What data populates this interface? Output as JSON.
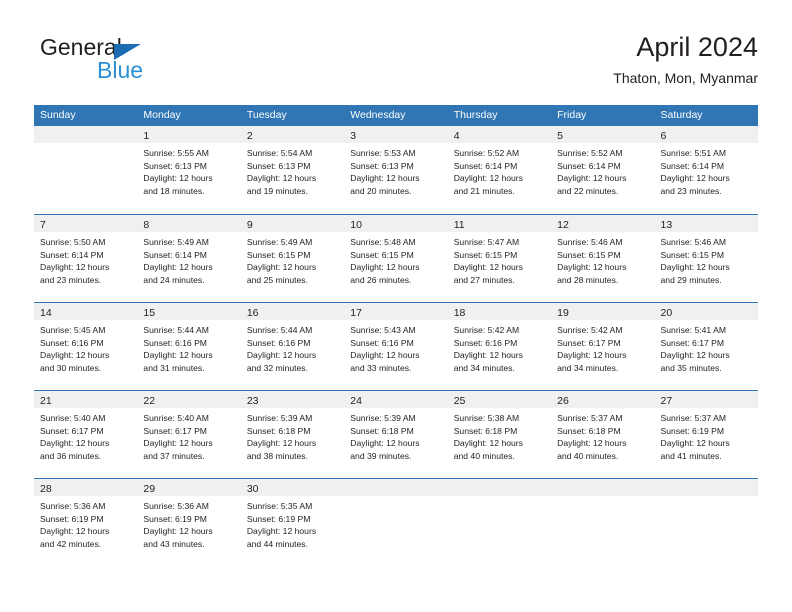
{
  "brand": {
    "name_top": "General",
    "name_bottom": "Blue",
    "triangle_icon": "blue-triangle-logo-mark",
    "color_dark": "#231f20",
    "color_blue": "#2b8fd4",
    "color_triangle": "#1b6cb3"
  },
  "header": {
    "title": "April 2024",
    "subtitle": "Thaton, Mon, Myanmar"
  },
  "theme": {
    "header_blue": "#3075b4",
    "day_band_gray": "#f0f0f0",
    "text": "#231f20"
  },
  "weekdays": [
    "Sunday",
    "Monday",
    "Tuesday",
    "Wednesday",
    "Thursday",
    "Friday",
    "Saturday"
  ],
  "weeks": [
    [
      {
        "day": "",
        "lines": []
      },
      {
        "day": "1",
        "lines": [
          "Sunrise: 5:55 AM",
          "Sunset: 6:13 PM",
          "Daylight: 12 hours",
          "and 18 minutes."
        ]
      },
      {
        "day": "2",
        "lines": [
          "Sunrise: 5:54 AM",
          "Sunset: 6:13 PM",
          "Daylight: 12 hours",
          "and 19 minutes."
        ]
      },
      {
        "day": "3",
        "lines": [
          "Sunrise: 5:53 AM",
          "Sunset: 6:13 PM",
          "Daylight: 12 hours",
          "and 20 minutes."
        ]
      },
      {
        "day": "4",
        "lines": [
          "Sunrise: 5:52 AM",
          "Sunset: 6:14 PM",
          "Daylight: 12 hours",
          "and 21 minutes."
        ]
      },
      {
        "day": "5",
        "lines": [
          "Sunrise: 5:52 AM",
          "Sunset: 6:14 PM",
          "Daylight: 12 hours",
          "and 22 minutes."
        ]
      },
      {
        "day": "6",
        "lines": [
          "Sunrise: 5:51 AM",
          "Sunset: 6:14 PM",
          "Daylight: 12 hours",
          "and 23 minutes."
        ]
      }
    ],
    [
      {
        "day": "7",
        "lines": [
          "Sunrise: 5:50 AM",
          "Sunset: 6:14 PM",
          "Daylight: 12 hours",
          "and 23 minutes."
        ]
      },
      {
        "day": "8",
        "lines": [
          "Sunrise: 5:49 AM",
          "Sunset: 6:14 PM",
          "Daylight: 12 hours",
          "and 24 minutes."
        ]
      },
      {
        "day": "9",
        "lines": [
          "Sunrise: 5:49 AM",
          "Sunset: 6:15 PM",
          "Daylight: 12 hours",
          "and 25 minutes."
        ]
      },
      {
        "day": "10",
        "lines": [
          "Sunrise: 5:48 AM",
          "Sunset: 6:15 PM",
          "Daylight: 12 hours",
          "and 26 minutes."
        ]
      },
      {
        "day": "11",
        "lines": [
          "Sunrise: 5:47 AM",
          "Sunset: 6:15 PM",
          "Daylight: 12 hours",
          "and 27 minutes."
        ]
      },
      {
        "day": "12",
        "lines": [
          "Sunrise: 5:46 AM",
          "Sunset: 6:15 PM",
          "Daylight: 12 hours",
          "and 28 minutes."
        ]
      },
      {
        "day": "13",
        "lines": [
          "Sunrise: 5:46 AM",
          "Sunset: 6:15 PM",
          "Daylight: 12 hours",
          "and 29 minutes."
        ]
      }
    ],
    [
      {
        "day": "14",
        "lines": [
          "Sunrise: 5:45 AM",
          "Sunset: 6:16 PM",
          "Daylight: 12 hours",
          "and 30 minutes."
        ]
      },
      {
        "day": "15",
        "lines": [
          "Sunrise: 5:44 AM",
          "Sunset: 6:16 PM",
          "Daylight: 12 hours",
          "and 31 minutes."
        ]
      },
      {
        "day": "16",
        "lines": [
          "Sunrise: 5:44 AM",
          "Sunset: 6:16 PM",
          "Daylight: 12 hours",
          "and 32 minutes."
        ]
      },
      {
        "day": "17",
        "lines": [
          "Sunrise: 5:43 AM",
          "Sunset: 6:16 PM",
          "Daylight: 12 hours",
          "and 33 minutes."
        ]
      },
      {
        "day": "18",
        "lines": [
          "Sunrise: 5:42 AM",
          "Sunset: 6:16 PM",
          "Daylight: 12 hours",
          "and 34 minutes."
        ]
      },
      {
        "day": "19",
        "lines": [
          "Sunrise: 5:42 AM",
          "Sunset: 6:17 PM",
          "Daylight: 12 hours",
          "and 34 minutes."
        ]
      },
      {
        "day": "20",
        "lines": [
          "Sunrise: 5:41 AM",
          "Sunset: 6:17 PM",
          "Daylight: 12 hours",
          "and 35 minutes."
        ]
      }
    ],
    [
      {
        "day": "21",
        "lines": [
          "Sunrise: 5:40 AM",
          "Sunset: 6:17 PM",
          "Daylight: 12 hours",
          "and 36 minutes."
        ]
      },
      {
        "day": "22",
        "lines": [
          "Sunrise: 5:40 AM",
          "Sunset: 6:17 PM",
          "Daylight: 12 hours",
          "and 37 minutes."
        ]
      },
      {
        "day": "23",
        "lines": [
          "Sunrise: 5:39 AM",
          "Sunset: 6:18 PM",
          "Daylight: 12 hours",
          "and 38 minutes."
        ]
      },
      {
        "day": "24",
        "lines": [
          "Sunrise: 5:39 AM",
          "Sunset: 6:18 PM",
          "Daylight: 12 hours",
          "and 39 minutes."
        ]
      },
      {
        "day": "25",
        "lines": [
          "Sunrise: 5:38 AM",
          "Sunset: 6:18 PM",
          "Daylight: 12 hours",
          "and 40 minutes."
        ]
      },
      {
        "day": "26",
        "lines": [
          "Sunrise: 5:37 AM",
          "Sunset: 6:18 PM",
          "Daylight: 12 hours",
          "and 40 minutes."
        ]
      },
      {
        "day": "27",
        "lines": [
          "Sunrise: 5:37 AM",
          "Sunset: 6:19 PM",
          "Daylight: 12 hours",
          "and 41 minutes."
        ]
      }
    ],
    [
      {
        "day": "28",
        "lines": [
          "Sunrise: 5:36 AM",
          "Sunset: 6:19 PM",
          "Daylight: 12 hours",
          "and 42 minutes."
        ]
      },
      {
        "day": "29",
        "lines": [
          "Sunrise: 5:36 AM",
          "Sunset: 6:19 PM",
          "Daylight: 12 hours",
          "and 43 minutes."
        ]
      },
      {
        "day": "30",
        "lines": [
          "Sunrise: 5:35 AM",
          "Sunset: 6:19 PM",
          "Daylight: 12 hours",
          "and 44 minutes."
        ]
      },
      {
        "day": "",
        "lines": []
      },
      {
        "day": "",
        "lines": []
      },
      {
        "day": "",
        "lines": []
      },
      {
        "day": "",
        "lines": []
      }
    ]
  ]
}
